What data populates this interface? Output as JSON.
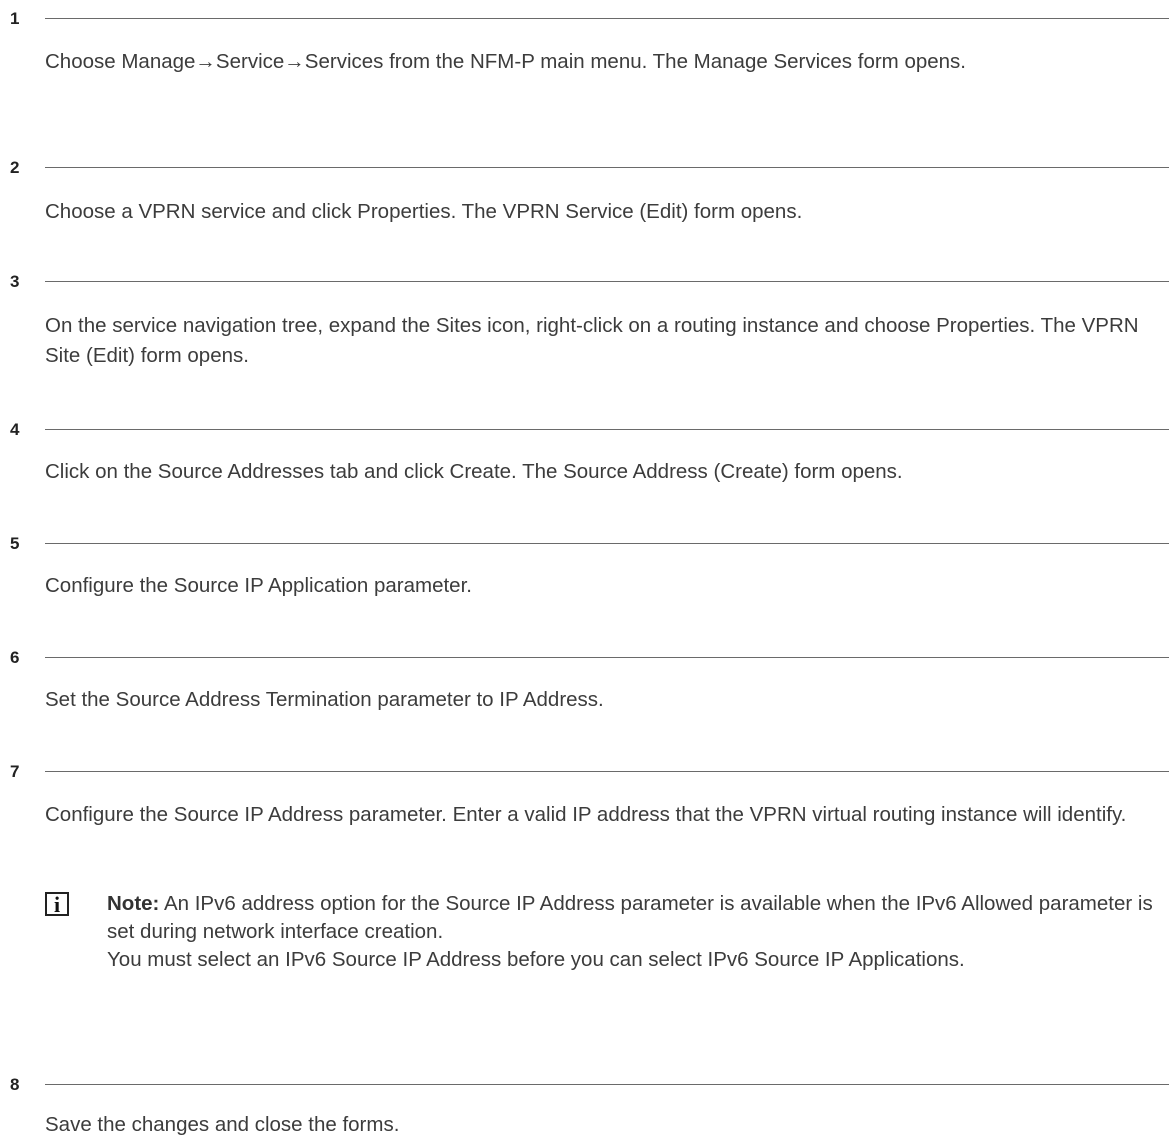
{
  "steps": [
    {
      "number": "1",
      "text": "Choose Manage→Service→Services from the NFM-P main menu. The Manage Services form opens."
    },
    {
      "number": "2",
      "text": "Choose a VPRN service and click Properties. The VPRN Service (Edit) form opens."
    },
    {
      "number": "3",
      "text": "On the service navigation tree, expand the Sites icon, right-click on a routing instance and choose Properties. The VPRN Site (Edit) form opens."
    },
    {
      "number": "4",
      "text": "Click on the Source Addresses tab and click Create. The Source Address (Create) form opens."
    },
    {
      "number": "5",
      "text": "Configure the Source IP Application parameter."
    },
    {
      "number": "6",
      "text": "Set the Source Address Termination parameter to IP Address."
    },
    {
      "number": "7",
      "text": "Configure the Source IP Address parameter. Enter a valid IP address that the VPRN virtual routing instance will identify.",
      "note": {
        "icon_symbol": "i",
        "label": "Note:",
        "line1": "An IPv6 address option for the Source IP Address parameter is available when the IPv6 Allowed parameter is set during network interface creation.",
        "line2": "You must select an IPv6 Source IP Address before you can select IPv6 Source IP Applications."
      }
    },
    {
      "number": "8",
      "text": "Save the changes and close the forms."
    }
  ]
}
